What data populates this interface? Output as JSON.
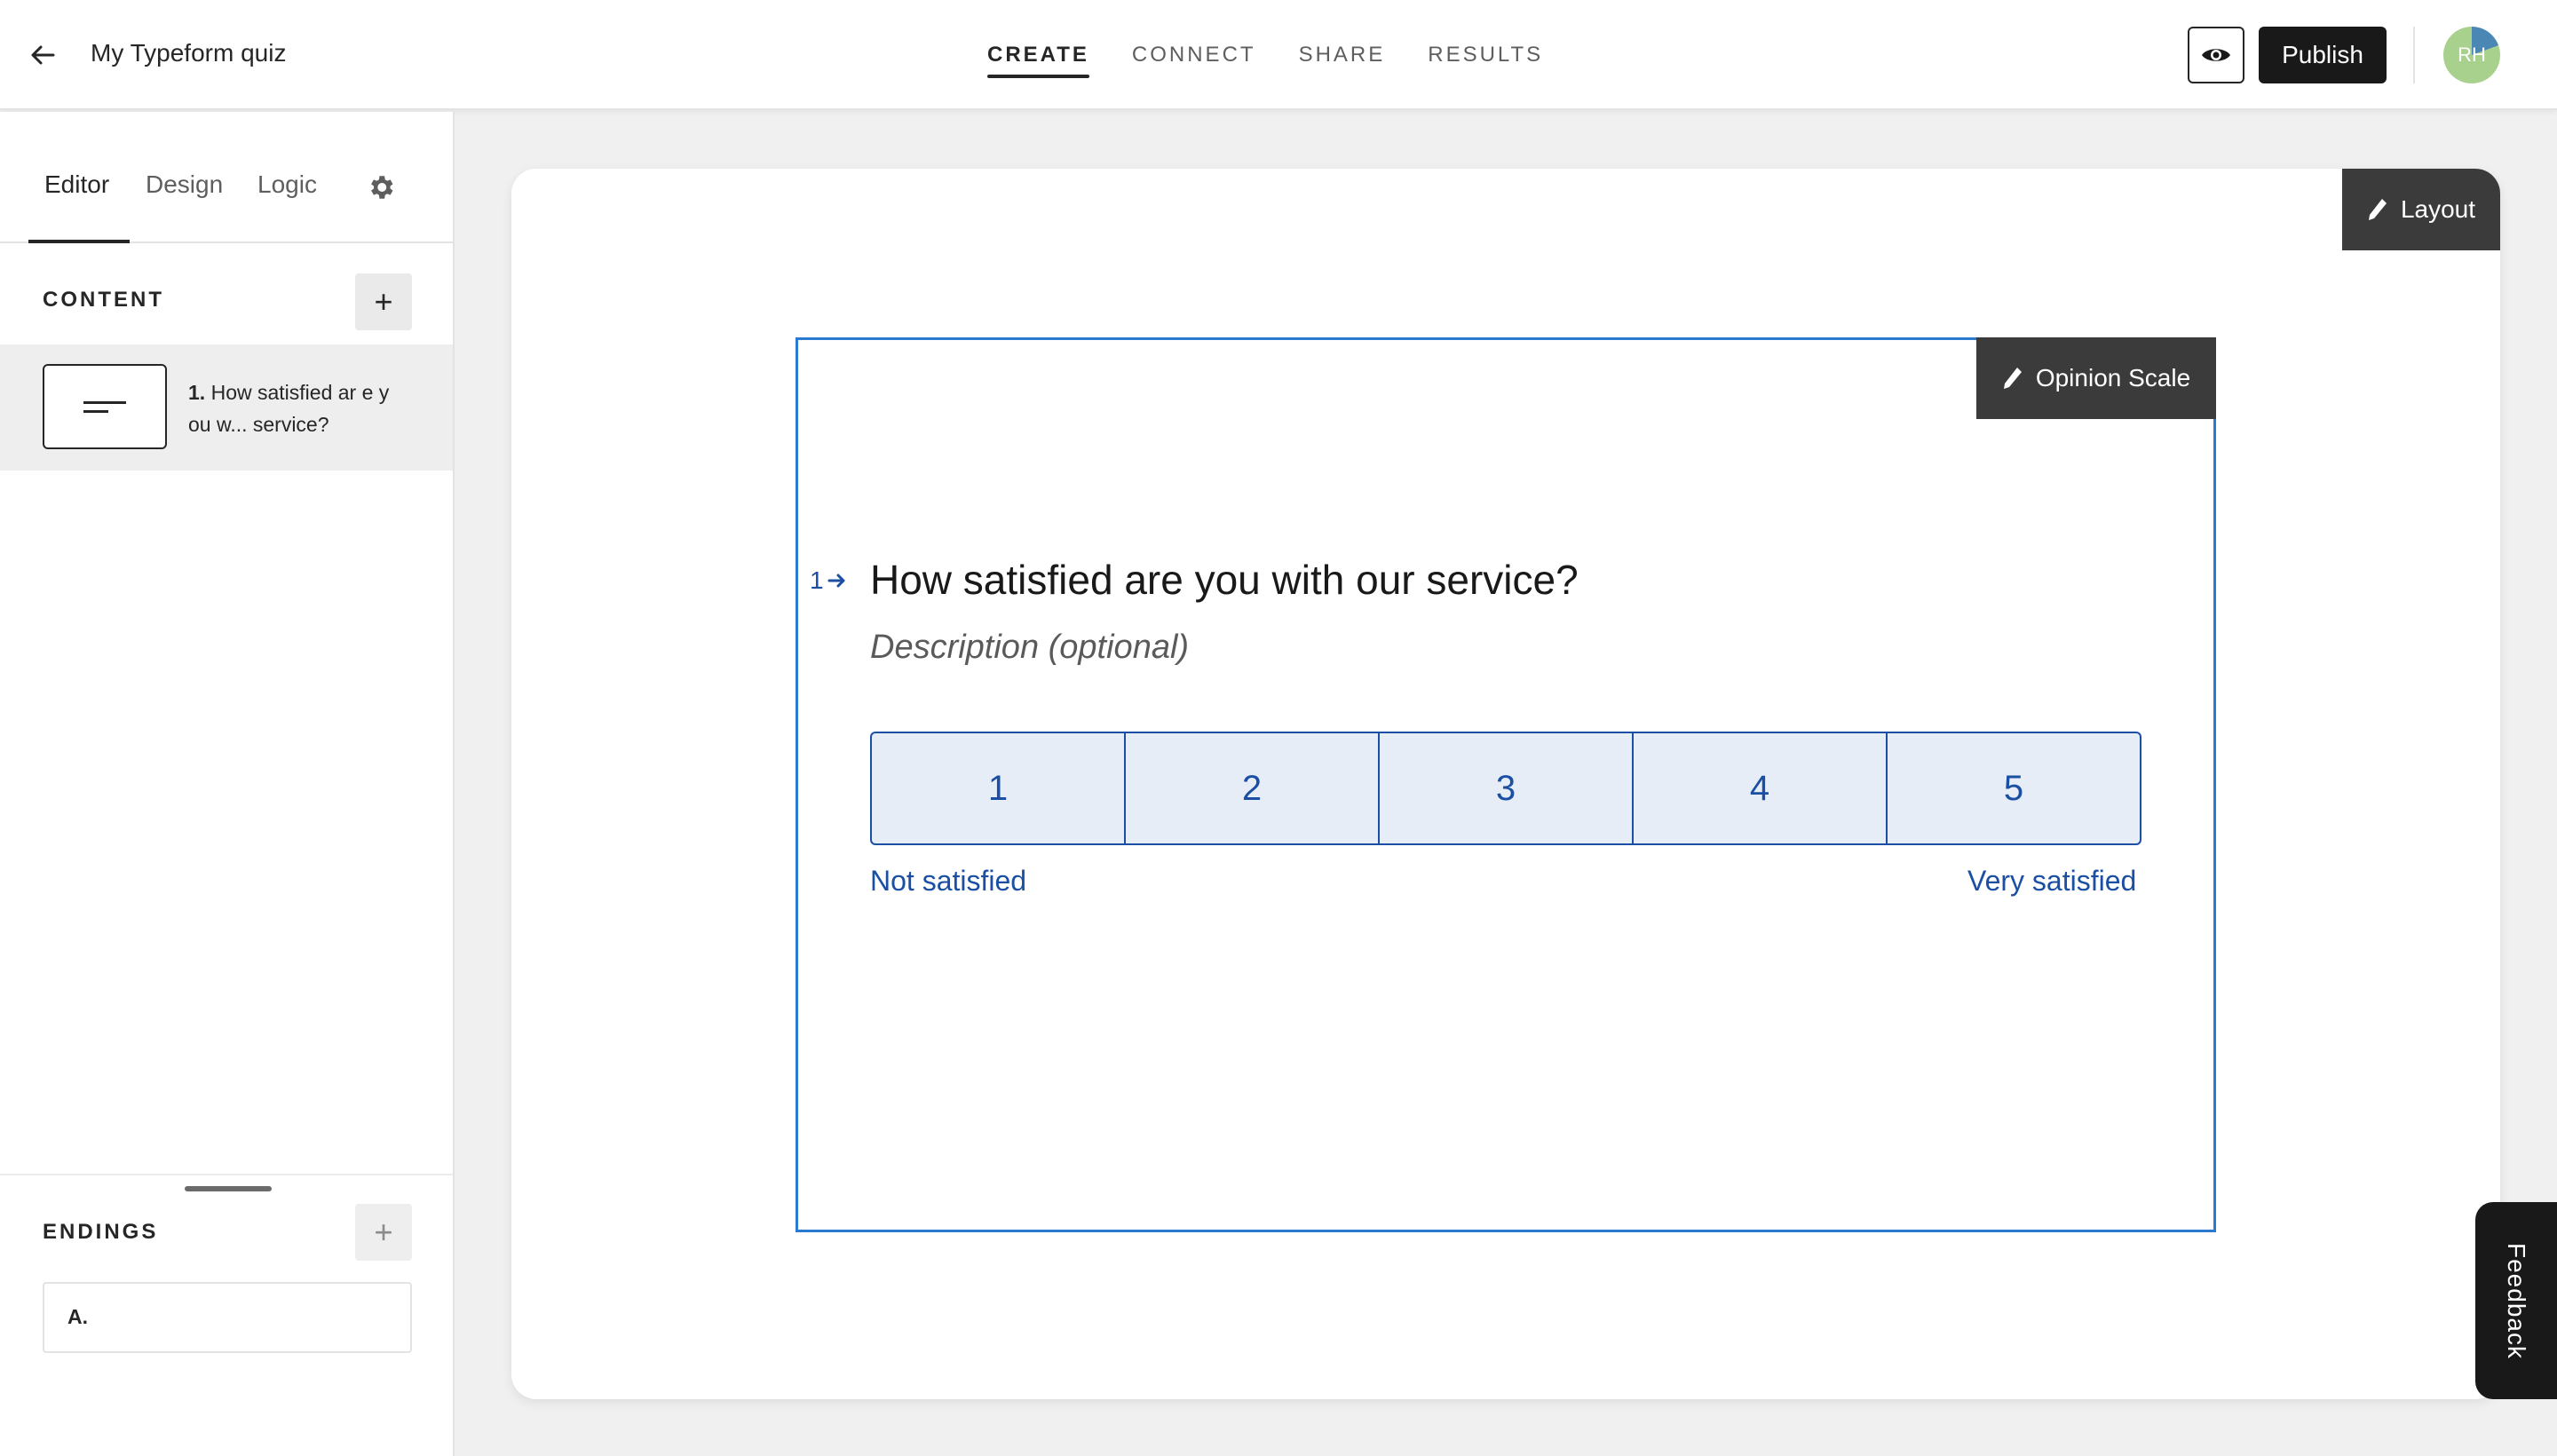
{
  "header": {
    "form_title": "My Typeform quiz",
    "tabs": [
      {
        "label": "CREATE",
        "active": true
      },
      {
        "label": "CONNECT",
        "active": false
      },
      {
        "label": "SHARE",
        "active": false
      },
      {
        "label": "RESULTS",
        "active": false
      }
    ],
    "publish_label": "Publish",
    "avatar_initials": "RH",
    "icons": {
      "back": "arrow-left-icon",
      "preview": "eye-icon"
    }
  },
  "sidebar": {
    "tabs": [
      {
        "label": "Editor",
        "active": true
      },
      {
        "label": "Design",
        "active": false
      },
      {
        "label": "Logic",
        "active": false
      }
    ],
    "settings_icon": "gear-icon",
    "content_title": "CONTENT",
    "add_label": "+",
    "questions": [
      {
        "number": "1.",
        "text": "How satisfied ar e you w... service?"
      }
    ],
    "endings_title": "ENDINGS",
    "endings": [
      {
        "label": "A."
      }
    ]
  },
  "canvas": {
    "layout_label": "Layout",
    "question_type_label": "Opinion Scale",
    "question_number": "1",
    "question_title": "How satisfied are you with our service?",
    "description_placeholder": "Description (optional)",
    "scale_options": [
      "1",
      "2",
      "3",
      "4",
      "5"
    ],
    "left_label": "Not satisfied",
    "right_label": "Very satisfied"
  },
  "feedback_label": "Feedback",
  "colors": {
    "accent": "#2a7ad1",
    "scale_text": "#1a4fa3",
    "scale_bg": "#e7edf7",
    "dark_button": "#191919"
  }
}
